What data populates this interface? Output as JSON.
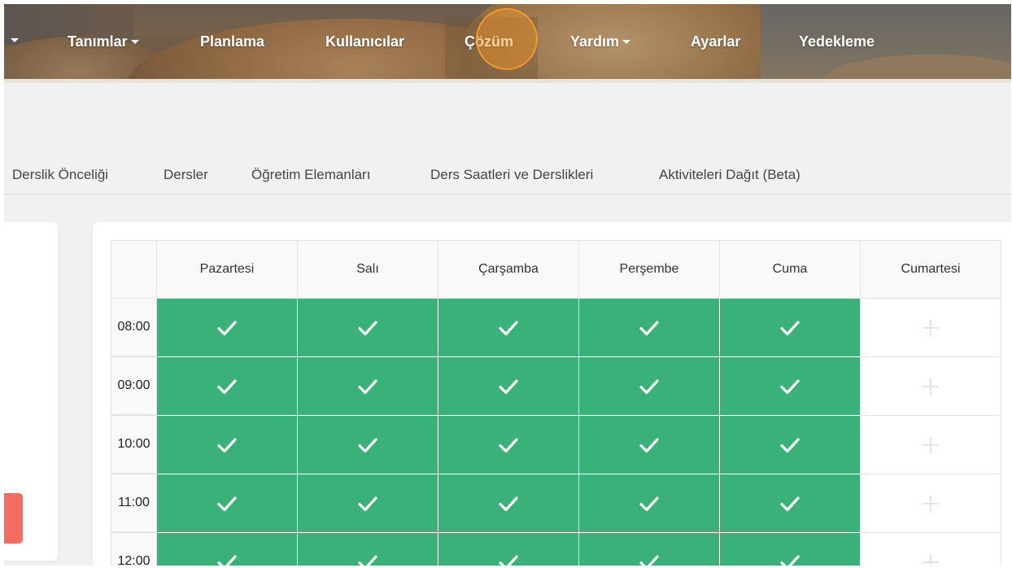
{
  "nav": {
    "items": [
      {
        "label": "Tanımlar",
        "has_caret": true
      },
      {
        "label": "Planlama",
        "has_caret": false
      },
      {
        "label": "Kullanıcılar",
        "has_caret": false
      },
      {
        "label": "Çözüm",
        "has_caret": false,
        "active": true
      },
      {
        "label": "Yardım",
        "has_caret": true
      },
      {
        "label": "Ayarlar",
        "has_caret": false
      },
      {
        "label": "Yedekleme",
        "has_caret": false
      }
    ]
  },
  "tabs": [
    "Derslik Önceliği",
    "Dersler",
    "Öğretim Elemanları",
    "Ders Saatleri ve Derslikleri",
    "Aktiviteleri Dağıt (Beta)"
  ],
  "schedule": {
    "days": [
      "Pazartesi",
      "Salı",
      "Çarşamba",
      "Perşembe",
      "Cuma",
      "Cumartesi"
    ],
    "times": [
      "08:00",
      "09:00",
      "10:00",
      "11:00",
      "12:00"
    ],
    "available": [
      [
        true,
        true,
        true,
        true,
        true,
        false
      ],
      [
        true,
        true,
        true,
        true,
        true,
        false
      ],
      [
        true,
        true,
        true,
        true,
        true,
        false
      ],
      [
        true,
        true,
        true,
        true,
        true,
        false
      ],
      [
        true,
        true,
        true,
        true,
        true,
        false
      ]
    ]
  },
  "icons": {
    "available": "check-icon",
    "unavailable": "plus-icon",
    "menu_caret": "caret-down-icon"
  },
  "colors": {
    "available": "#3bb17a",
    "active_highlight": "#f2962a",
    "danger_button": "#f46b5f"
  }
}
